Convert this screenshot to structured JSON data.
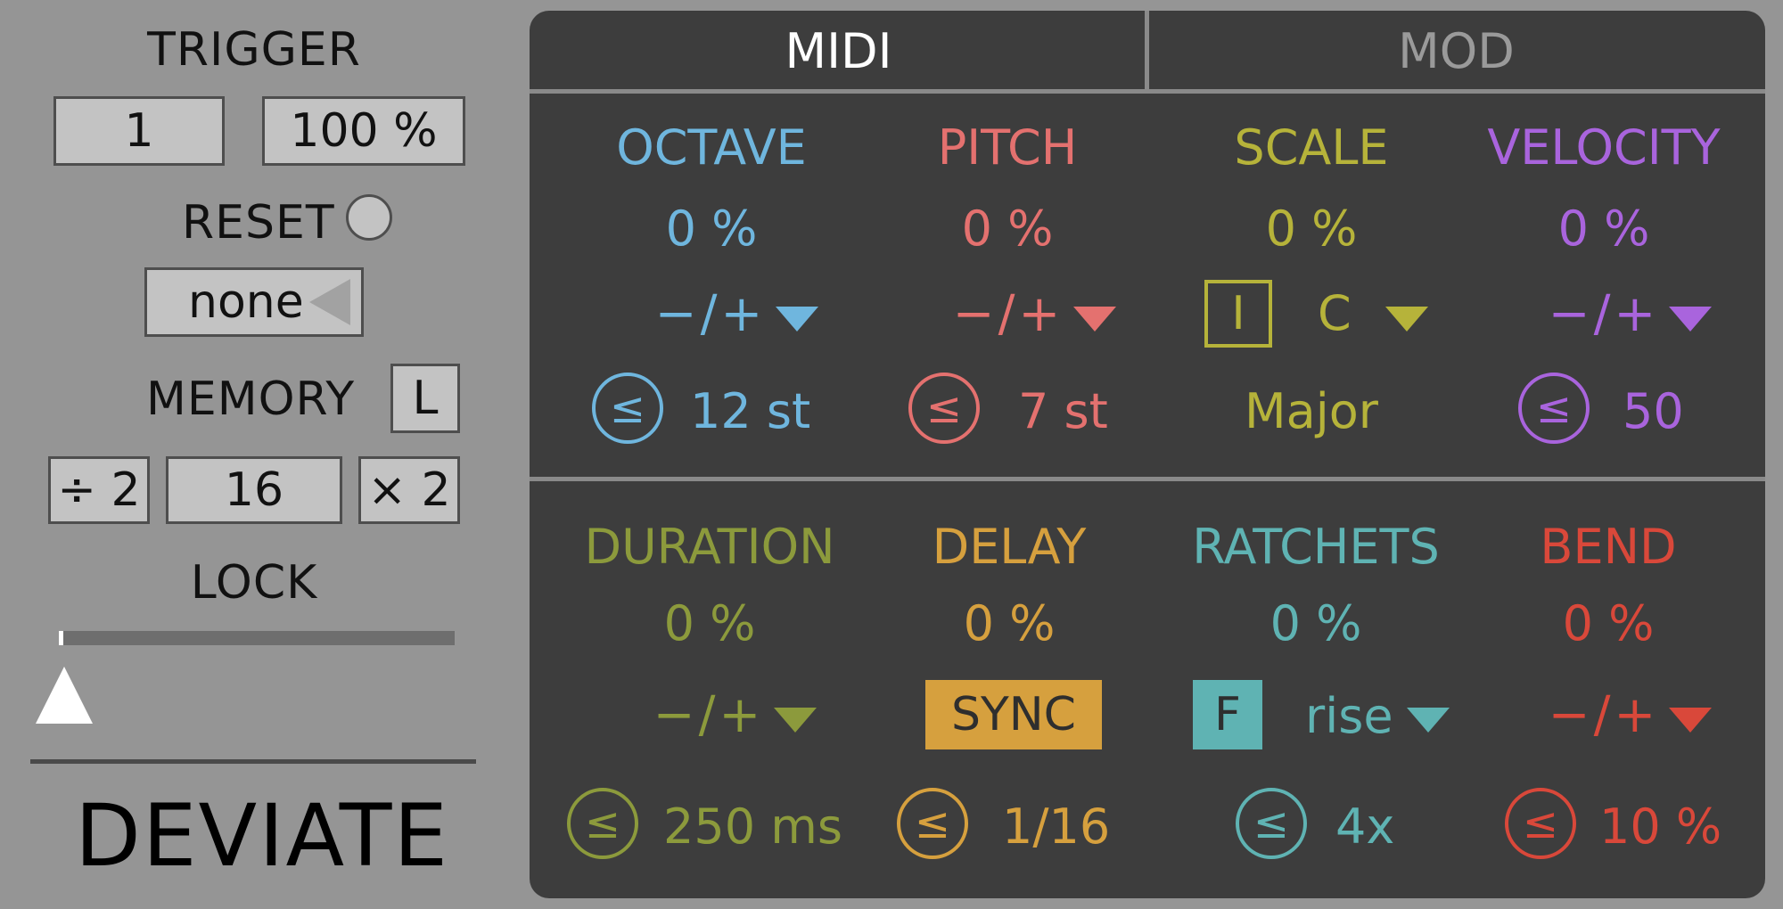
{
  "left": {
    "trigger_label": "TRIGGER",
    "trigger_value": "1",
    "trigger_prob": "100 %",
    "reset_label": "RESET",
    "reset_mode": "none",
    "memory_label": "MEMORY",
    "memory_button": "L",
    "memory_div": "÷ 2",
    "memory_length": "16",
    "memory_mul": "× 2",
    "lock_label": "LOCK",
    "lock_level": 0.0,
    "brand": "DEVIATE"
  },
  "tabs": {
    "midi": "MIDI",
    "mod": "MOD"
  },
  "colors": {
    "octave": "#6fb6de",
    "pitch": "#e4716f",
    "scale": "#b6b33a",
    "velocity": "#a964dd",
    "duration": "#8c9a3c",
    "delay": "#d6a03e",
    "ratchets": "#5fb3b3",
    "bend": "#d9483a"
  },
  "params": {
    "octave": {
      "label": "OCTAVE",
      "value": "0 %",
      "mode": "−/+",
      "range": "12 st",
      "icon": "less-equal-icon"
    },
    "pitch": {
      "label": "PITCH",
      "value": "0 %",
      "mode": "−/+",
      "range": "7 st",
      "icon": "less-equal-icon"
    },
    "scale": {
      "label": "SCALE",
      "value": "0 %",
      "toggle": "I",
      "key": "C",
      "scale_name": "Major"
    },
    "velocity": {
      "label": "VELOCITY",
      "value": "0 %",
      "mode": "−/+",
      "range": "50",
      "icon": "less-equal-icon"
    },
    "duration": {
      "label": "DURATION",
      "value": "0 %",
      "mode": "−/+",
      "range": "250 ms",
      "icon": "less-equal-icon"
    },
    "delay": {
      "label": "DELAY",
      "value": "0 %",
      "sync": "SYNC",
      "range": "1/16",
      "icon": "less-equal-icon"
    },
    "ratchets": {
      "label": "RATCHETS",
      "value": "0 %",
      "toggle": "F",
      "shape": "rise",
      "range": "4x",
      "icon": "less-equal-icon"
    },
    "bend": {
      "label": "BEND",
      "value": "0 %",
      "mode": "−/+",
      "range": "10 %",
      "icon": "less-equal-icon"
    }
  },
  "glyphs": {
    "less_equal": "≤"
  }
}
